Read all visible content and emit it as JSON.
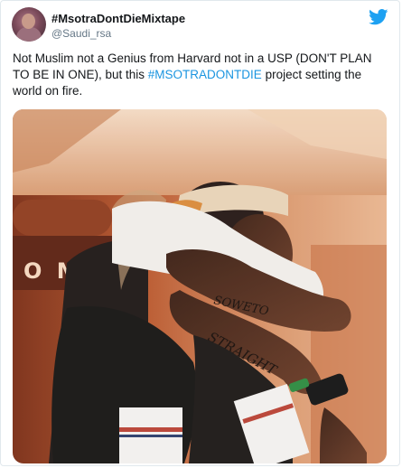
{
  "tweet": {
    "display_name": "#MsotraDontDieMixtape",
    "handle": "@Saudi_rsa",
    "text_before": "Not Muslim not a Genius from Harvard not in a USP (DON'T PLAN TO BE IN ONE), but this ",
    "hashtag": "#MSOTRADONTDIE",
    "text_after": " project setting the world on fire."
  },
  "media": {
    "sign_letters": "O M E",
    "tattoo_upper": "SOWETO",
    "tattoo_lower": "STRAIGHT"
  },
  "colors": {
    "twitter_blue": "#1da1f2",
    "hashtag": "#1b95e0"
  },
  "icons": {
    "brand": "twitter-bird-icon"
  }
}
